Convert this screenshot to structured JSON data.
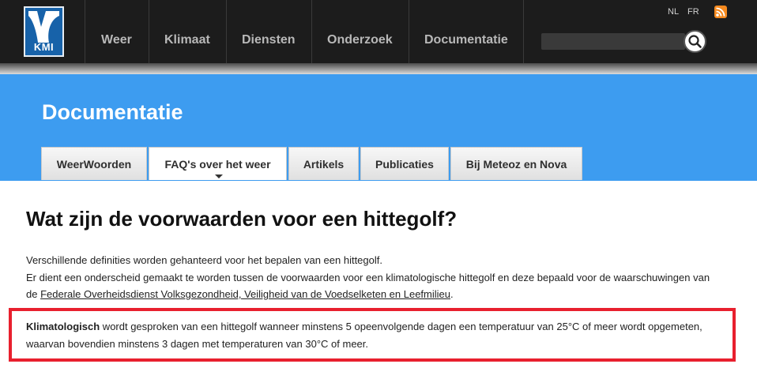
{
  "header": {
    "logo_text": "KMI",
    "nav": [
      "Weer",
      "Klimaat",
      "Diensten",
      "Onderzoek",
      "Documentatie"
    ],
    "languages": [
      "NL",
      "FR"
    ],
    "search": {
      "value": "",
      "placeholder": ""
    },
    "icons": {
      "search": "search-icon",
      "rss": "rss-feed-icon"
    }
  },
  "banner": {
    "title": "Documentatie",
    "tabs": [
      "WeerWoorden",
      "FAQ's over het weer",
      "Artikels",
      "Publicaties",
      "Bij Meteoz en Nova"
    ],
    "active_tab": "FAQ's over het weer"
  },
  "article": {
    "title": "Wat zijn de voorwaarden voor een hittegolf?",
    "intro_line1": "Verschillende definities worden gehanteerd voor het bepalen van een hittegolf.",
    "intro_line2": "Er dient een onderscheid gemaakt te worden tussen de voorwaarden voor een klimatologische hittegolf en deze bepaald voor de waarschuwingen van",
    "intro_line3_prefix": "de ",
    "intro_link": "Federale Overheidsdienst Volksgezondheid, Veiligheid van de Voedselketen en Leefmilieu",
    "intro_line3_suffix": ".",
    "box_bold": "Klimatologisch",
    "box_line1_rest": " wordt gesproken van een hittegolf wanneer minstens 5 opeenvolgende dagen een temperatuur van 25°C of meer wordt opgemeten,",
    "box_line2": "waarvan bovendien minstens 3 dagen met temperaturen van 30°C of meer."
  },
  "colors": {
    "header_bg": "#1c1c1c",
    "banner_blue": "#3d9cf0",
    "logo_blue": "#1762a9",
    "highlight_red": "#e8202e",
    "rss_orange": "#f68a1f"
  }
}
